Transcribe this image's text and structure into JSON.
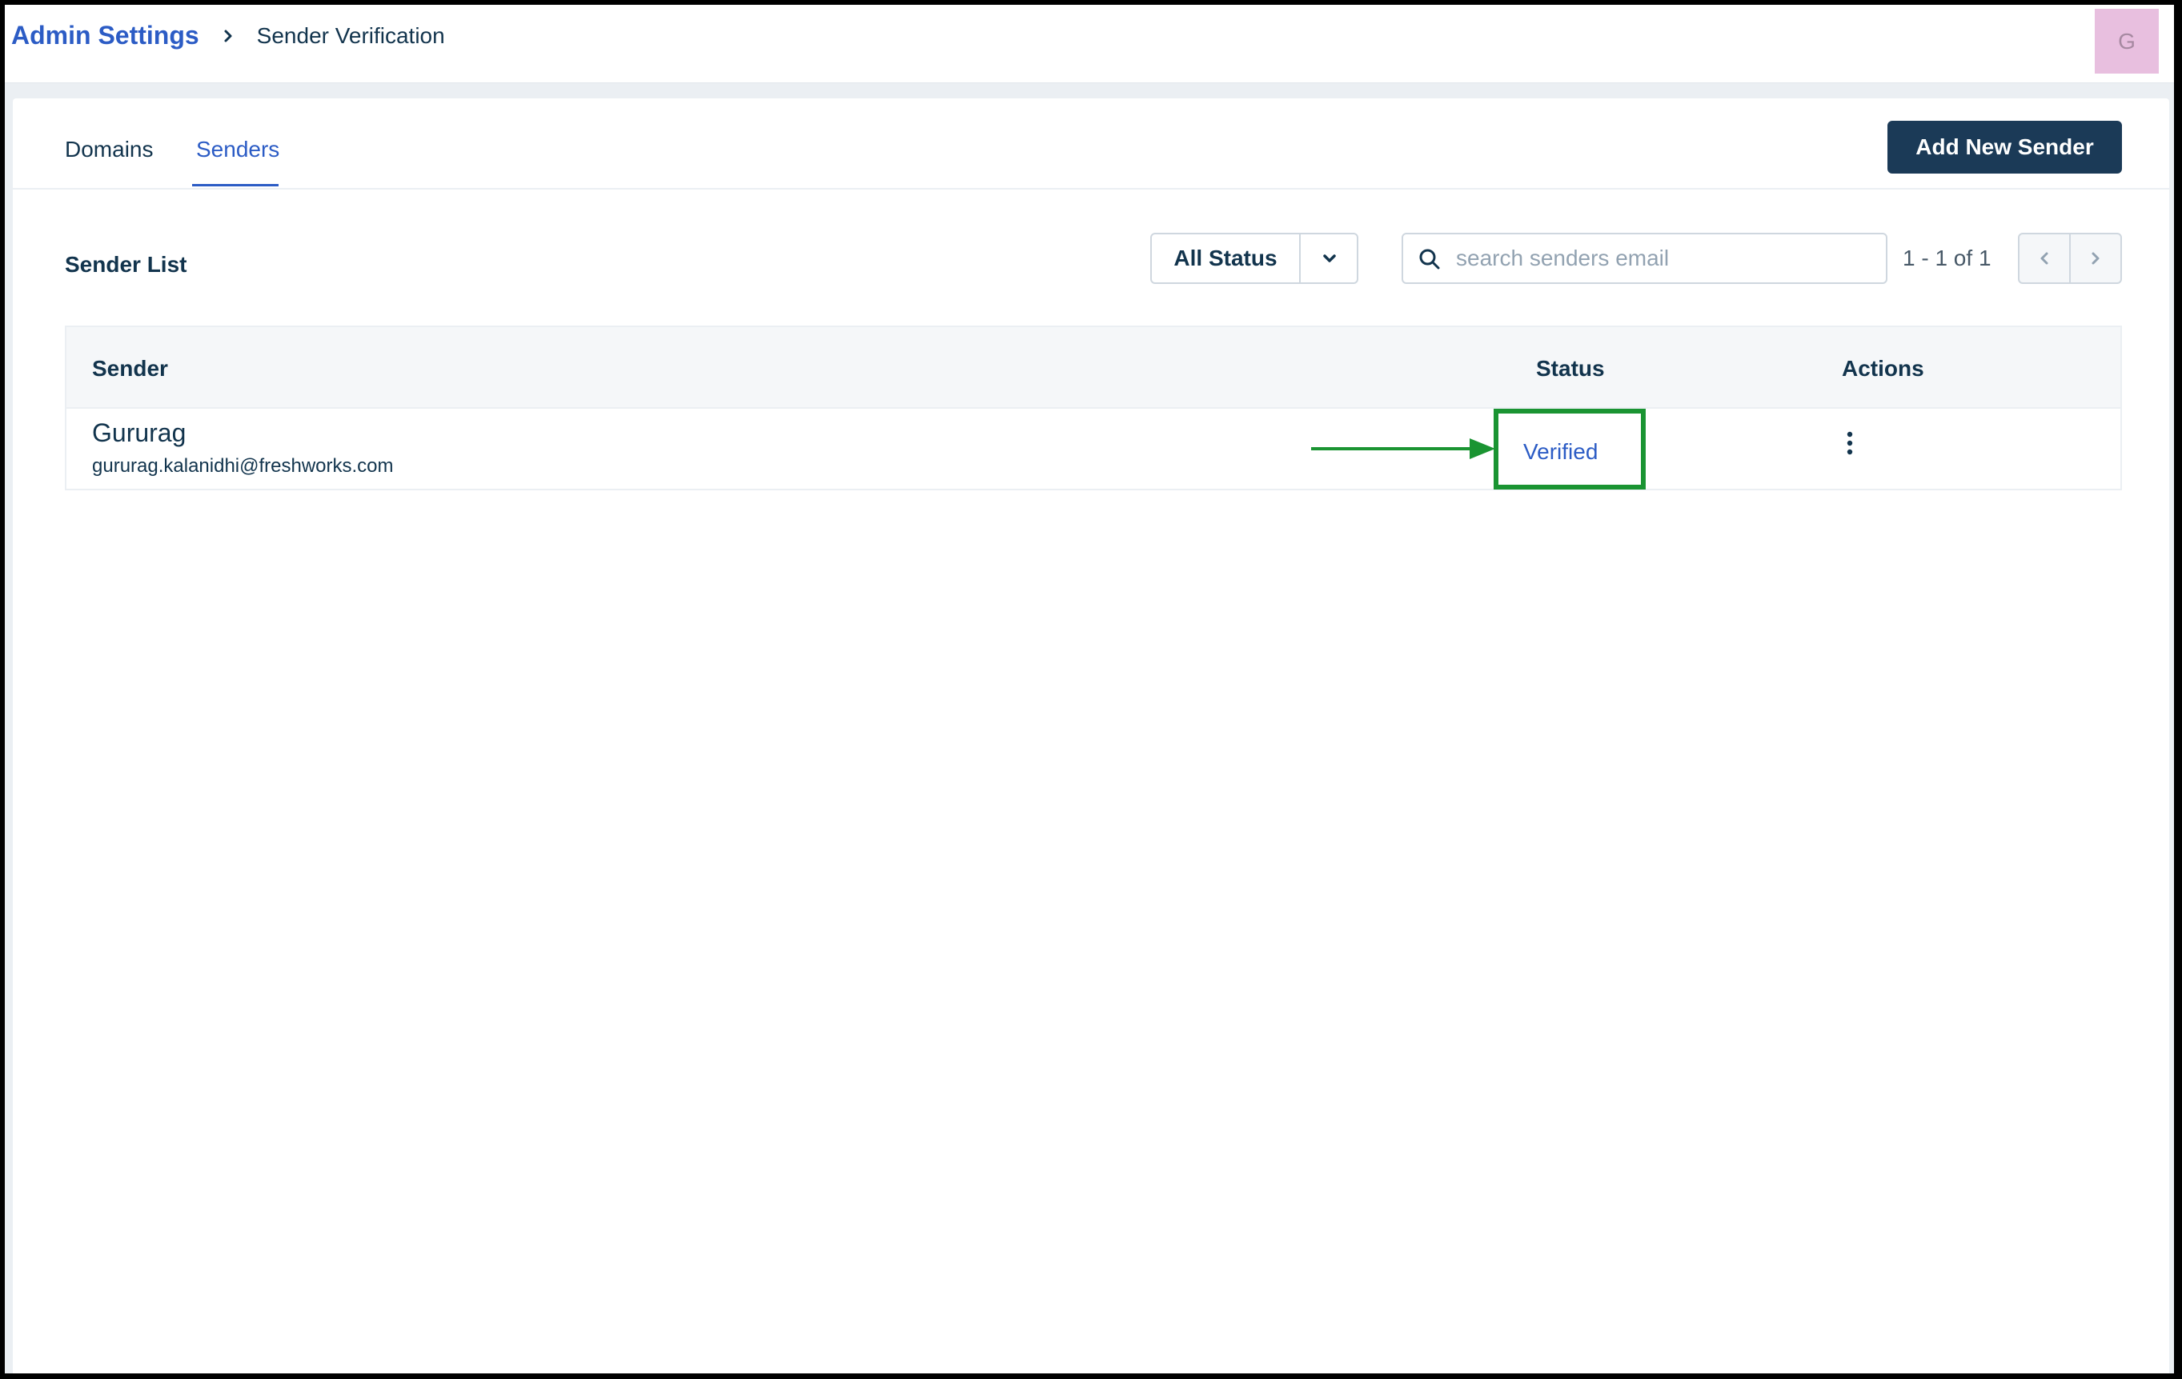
{
  "header": {
    "breadcrumb_root": "Admin Settings",
    "breadcrumb_current": "Sender Verification",
    "avatar_initial": "G"
  },
  "tabs": [
    {
      "label": "Domains",
      "active": false
    },
    {
      "label": "Senders",
      "active": true
    }
  ],
  "toolbar": {
    "add_button_label": "Add New Sender",
    "list_title": "Sender List",
    "status_filter_value": "All Status",
    "search_placeholder": "search senders email",
    "pagination_text": "1 - 1 of 1"
  },
  "table": {
    "columns": [
      "Sender",
      "Status",
      "Actions"
    ],
    "rows": [
      {
        "name": "Gururag",
        "email": "gururag.kalanidhi@freshworks.com",
        "status": "Verified"
      }
    ]
  },
  "icons": {
    "breadcrumb_separator": "chevron-right-icon",
    "dropdown": "chevron-down-icon",
    "search": "search-icon",
    "prev": "chevron-left-icon",
    "next": "chevron-right-icon",
    "actions": "more-vertical-icon"
  },
  "colors": {
    "accent": "#2c5cc5",
    "primary_button": "#1b3a57",
    "annotation": "#1a9432",
    "avatar_bg": "#e8bfdf"
  }
}
